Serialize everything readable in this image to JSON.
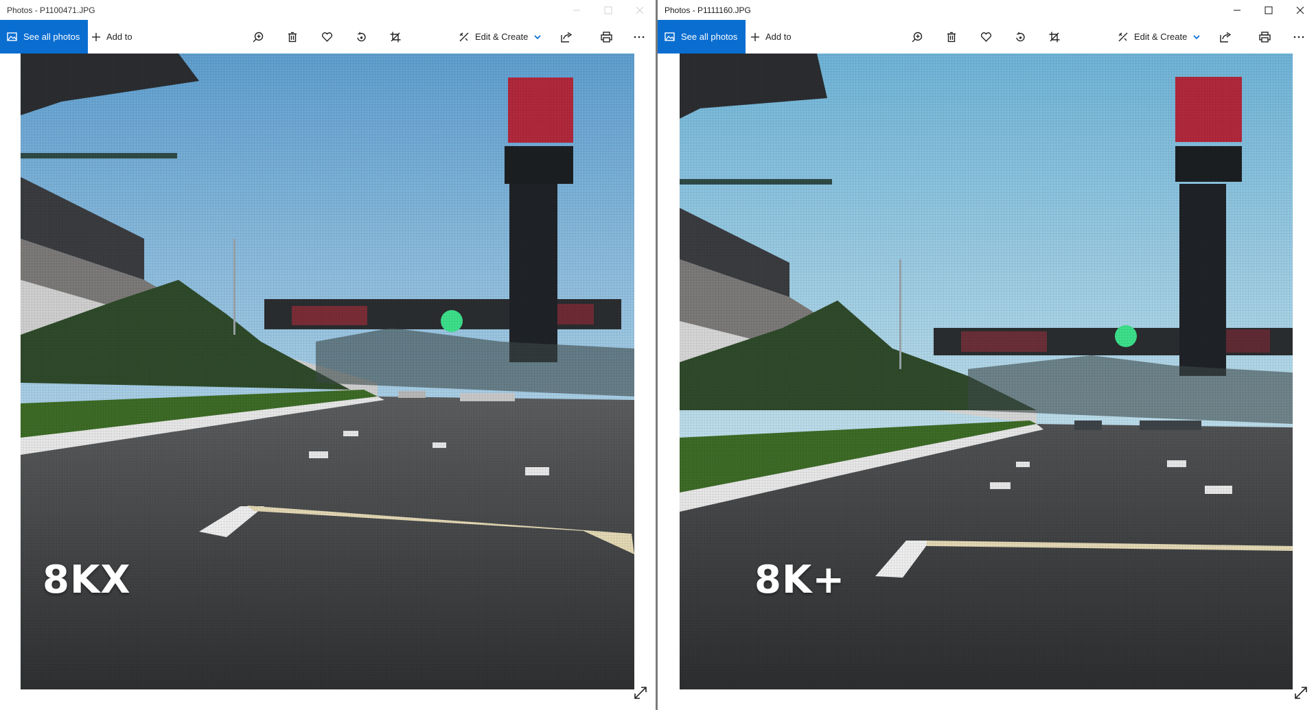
{
  "left_window": {
    "title": "Photos - P1100471.JPG",
    "see_all": "See all photos",
    "add_to": "Add to",
    "edit_create": "Edit & Create",
    "caption": "8KX",
    "window_active": false
  },
  "right_window": {
    "title": "Photos - P1111160.JPG",
    "see_all": "See all photos",
    "add_to": "Add to",
    "edit_create": "Edit & Create",
    "caption": "8K+",
    "window_active": true
  },
  "toolbar_icons": [
    "zoom-in-icon",
    "delete-icon",
    "favorite-heart-icon",
    "rotate-icon",
    "crop-icon",
    "share-icon",
    "print-icon",
    "more-icon"
  ],
  "colors": {
    "accent": "#0a6ed1",
    "divider": "#7a7a7a"
  }
}
